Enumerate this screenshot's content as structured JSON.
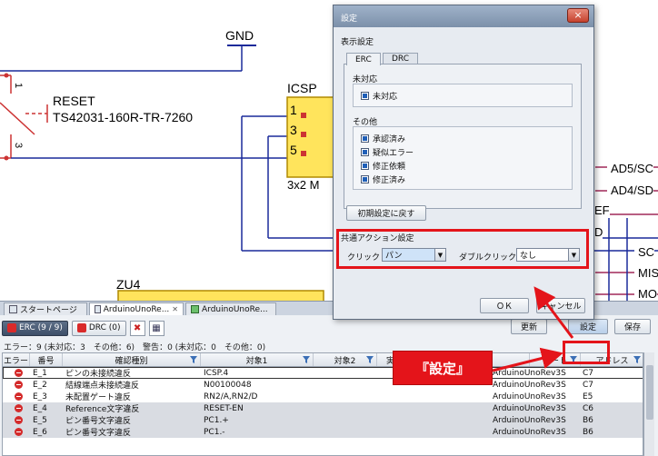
{
  "schematic": {
    "gnd": "GND",
    "reset_ref": "RESET",
    "reset_part": "TS42031-160R-TR-7260",
    "pin1": "1",
    "pin3": "3",
    "icsp_ref": "ICSP",
    "icsp_value": "3x2 M",
    "icsp_pins": [
      "1",
      "3",
      "5"
    ],
    "zu4": "ZU4",
    "nets": [
      "AD5/SC",
      "AD4/SD",
      "EF",
      "D",
      "SC",
      "MIS",
      "MO"
    ]
  },
  "doc_tabs": [
    {
      "label": "スタートページ",
      "icon": "page-icon"
    },
    {
      "label": "ArduinoUnoRe...",
      "icon": "schematic-icon"
    },
    {
      "label": "ArduinoUnoRe...",
      "icon": "pcb-icon"
    }
  ],
  "toolbar": {
    "erc_label": "ERC (9 / 9)",
    "drc_label": "DRC (0)",
    "update_label": "更新",
    "settings_label": "設定",
    "save_label": "保存"
  },
  "summary": "エラー：9 (未対応：3　その他：6)　警告：0 (未対応：0　その他：0)",
  "grid": {
    "columns": [
      "エラー",
      "番号",
      "確認種別",
      "対象1",
      "対象2",
      "実",
      "シート",
      "アドレス"
    ],
    "rows": [
      {
        "num": "E_1",
        "type": "ピンの未接続違反",
        "target1": "ICSP.4",
        "target2": "",
        "sheet": "ArduinoUnoRev3S",
        "addr": "C7"
      },
      {
        "num": "E_2",
        "type": "結線端点未接続違反",
        "target1": "N00100048",
        "target2": "",
        "sheet": "ArduinoUnoRev3S",
        "addr": "C7"
      },
      {
        "num": "E_3",
        "type": "未配置ゲート違反",
        "target1": "RN2/A,RN2/D",
        "target2": "",
        "sheet": "ArduinoUnoRev3S",
        "addr": "E5"
      },
      {
        "num": "E_4",
        "type": "Reference文字違反",
        "target1": "RESET-EN",
        "target2": "",
        "sheet": "ArduinoUnoRev3S",
        "addr": "C6"
      },
      {
        "num": "E_5",
        "type": "ピン番号文字違反",
        "target1": "PC1.+",
        "target2": "",
        "sheet": "ArduinoUnoRev3S",
        "addr": "B6"
      },
      {
        "num": "E_6",
        "type": "ピン番号文字違反",
        "target1": "PC1.-",
        "target2": "",
        "sheet": "ArduinoUnoRev3S",
        "addr": "B6"
      }
    ]
  },
  "dialog": {
    "title": "設定",
    "close": "×",
    "display_group": "表示設定",
    "tabs": [
      "ERC",
      "DRC"
    ],
    "unhandled_title": "未対応",
    "unhandled_items": [
      {
        "label": "未対応",
        "checked": true
      }
    ],
    "other_title": "その他",
    "other_items": [
      {
        "label": "承認済み",
        "checked": true
      },
      {
        "label": "疑似エラー",
        "checked": true
      },
      {
        "label": "修正依頼",
        "checked": true
      },
      {
        "label": "修正済み",
        "checked": true
      }
    ],
    "reset_button": "初期設定に戻す",
    "action_group": "共通アクション設定",
    "click_label": "クリック",
    "click_value": "パン",
    "dblclick_label": "ダブルクリック",
    "dblclick_value": "なし",
    "ok_label": "ＯＫ",
    "cancel_label": "キャンセル"
  },
  "callout": "『設定』",
  "colors": {
    "accent": "#e4141a",
    "titlebar": "#8ea2bc",
    "part_fill": "#ffe45c"
  }
}
